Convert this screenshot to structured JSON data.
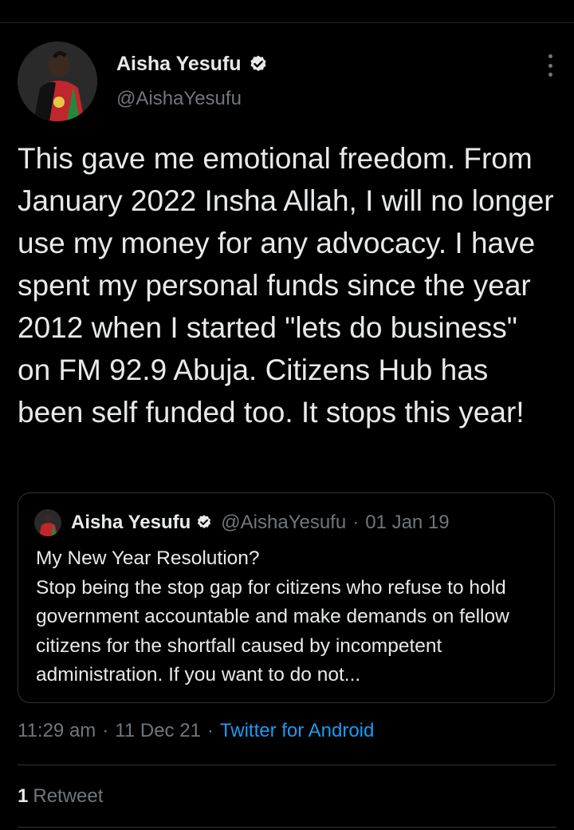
{
  "author": {
    "name": "Aisha Yesufu",
    "handle": "@AishaYesufu",
    "verified_icon": "verified-badge-icon",
    "avatar_icon": "avatar"
  },
  "tweet": {
    "text": "This gave me emotional freedom. From January 2022 Insha Allah, I will no longer use my money for any advocacy. I have spent my personal funds since the year 2012 when I started \"lets do business\" on FM 92.9 Abuja. Citizens Hub has been self funded too. It stops this year!"
  },
  "quoted_tweet": {
    "name": "Aisha Yesufu",
    "handle": "@AishaYesufu",
    "separator": "·",
    "date": "01 Jan 19",
    "text": "My New Year Resolution?\nStop being the stop gap for citizens who refuse to hold government accountable and make demands on fellow citizens for the shortfall caused by incompetent administration. If you want to do not..."
  },
  "meta": {
    "time": "11:29 am",
    "separator": "·",
    "date": "11 Dec 21",
    "source": "Twitter for Android"
  },
  "stats": {
    "retweet_count": "1",
    "retweet_label": "Retweet"
  },
  "colors": {
    "background": "#000000",
    "text": "#e7e9ea",
    "secondary": "#71767b",
    "accent": "#1d9bf0",
    "border": "#2f3336"
  }
}
